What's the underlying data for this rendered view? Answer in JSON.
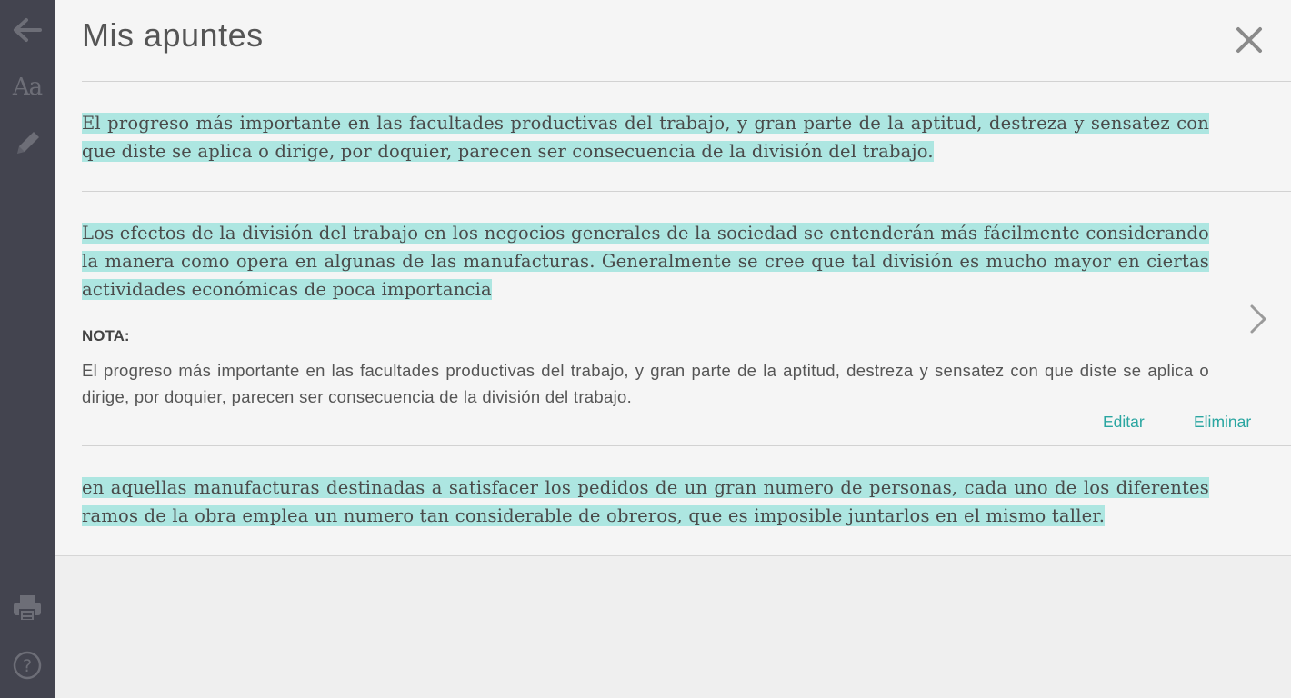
{
  "sidebar": {
    "items": [
      {
        "name": "back",
        "icon": "arrow-left-icon"
      },
      {
        "name": "font",
        "icon": "font-size-icon",
        "label": "Aa"
      },
      {
        "name": "notes",
        "icon": "pencil-icon"
      },
      {
        "name": "print",
        "icon": "printer-icon"
      },
      {
        "name": "help",
        "icon": "help-icon"
      }
    ],
    "background": "#43444f"
  },
  "panel": {
    "title": "Mis apuntes",
    "close_icon": "close-icon",
    "accent_color": "#2aa6a1",
    "highlight_color": "#ade6e1"
  },
  "notes": [
    {
      "highlight": "El progreso más importante en las facultades productivas del trabajo, y gran parte de la aptitud, destreza y sensatez con que diste se aplica o dirige, por doquier, parecen ser consecuencia de la división del trabajo."
    },
    {
      "highlight": "Los efectos de la división del trabajo en los negocios generales de la sociedad se entenderán más fácilmente considerando la manera como opera en algunas de las manufacturas. Generalmente se cree que tal división es mucho mayor en ciertas actividades económicas de poca importancia",
      "note_label": "NOTA:",
      "note_text": "El progreso más importante en las facultades productivas del trabajo, y gran parte de la aptitud, destreza y sensatez con que diste se aplica o dirige, por doquier, parecen ser consecuencia de la división del trabajo.",
      "edit_label": "Editar",
      "delete_label": "Eliminar"
    },
    {
      "highlight": "en aquellas manufacturas destinadas a satisfacer los pedidos de un gran numero de personas, cada uno de los diferentes ramos de la obra emplea un numero tan considerable de obreros, que es imposible juntarlos en el mismo taller."
    }
  ]
}
